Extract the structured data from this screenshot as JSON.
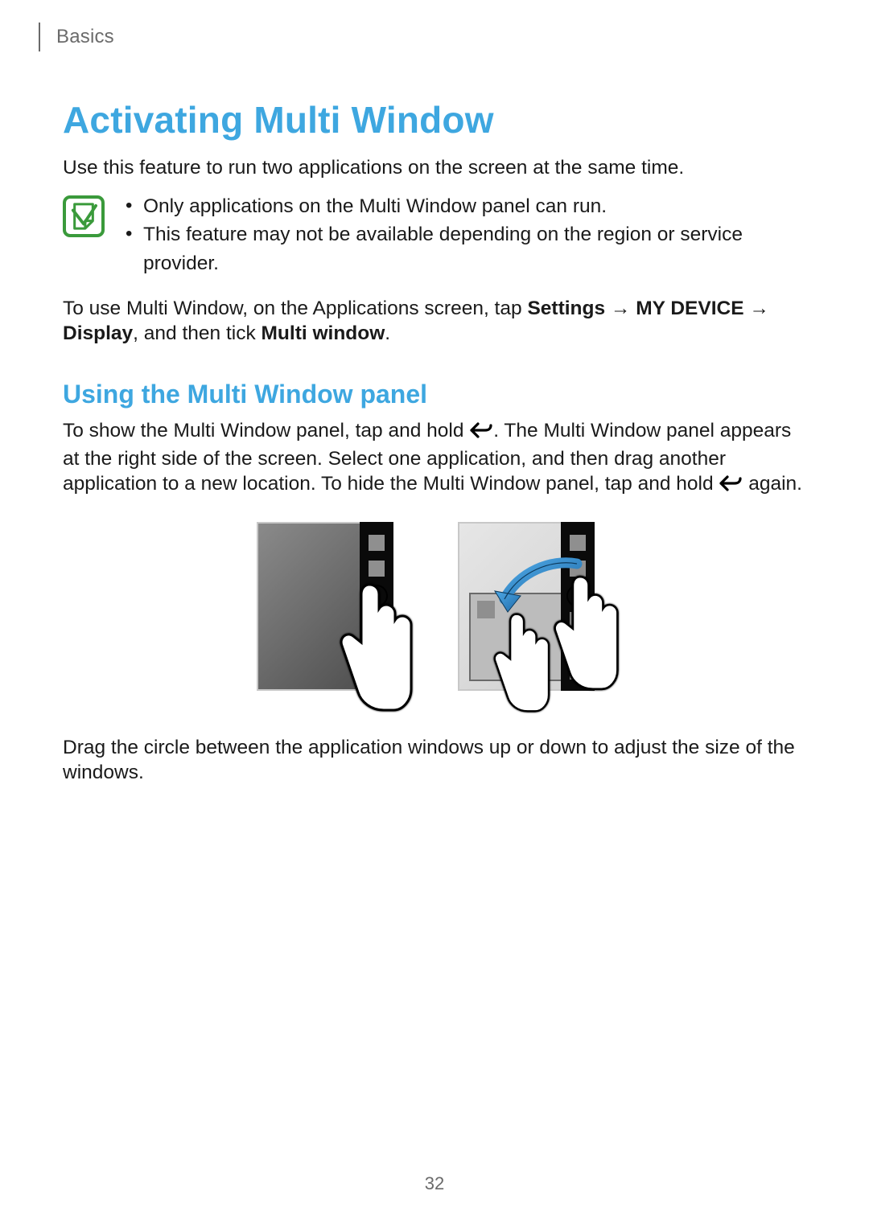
{
  "chapter": "Basics",
  "title": "Activating Multi Window",
  "intro": "Use this feature to run two applications on the screen at the same time.",
  "note": {
    "items": [
      "Only applications on the Multi Window panel can run.",
      "This feature may not be available depending on the region or service provider."
    ]
  },
  "prereq": {
    "prefix": "To use Multi Window, on the Applications screen, tap ",
    "settings": "Settings",
    "arrow": " → ",
    "mydevice": "MY DEVICE",
    "display": "Display",
    "mid": ", and then tick ",
    "multiwin": "Multi window",
    "suffix": "."
  },
  "subhead": "Using the Multi Window panel",
  "panel": {
    "p1a": "To show the Multi Window panel, tap and hold ",
    "p1b": ". The Multi Window panel appears at the right side of the screen. Select one application, and then drag another application to a new location. To hide the Multi Window panel, tap and hold ",
    "p1c": " again."
  },
  "drag_hint": "Drag the circle between the application windows up or down to adjust the size of the windows.",
  "page_number": "32"
}
